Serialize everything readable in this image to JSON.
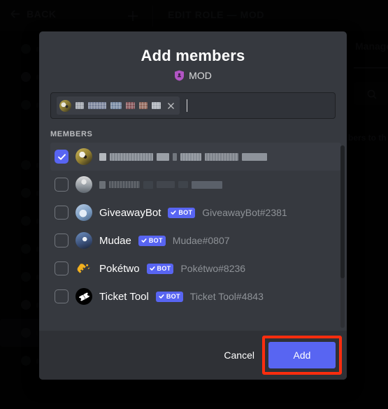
{
  "background": {
    "back_label": "BACK",
    "back_icon": "arrow-left-icon",
    "add_icon": "plus-icon",
    "page_title": "EDIT ROLE — MOD",
    "tab_label": "Manage",
    "search_icon": "search-icon",
    "hint_text": "bers to th"
  },
  "modal": {
    "title": "Add members",
    "role": {
      "name": "MOD",
      "icon": "role-shield-icon",
      "color": "#b155c4"
    },
    "search": {
      "placeholder": "",
      "value": "",
      "token": {
        "avatar": "user-avatar",
        "name_redacted": true,
        "remove_icon": "close-icon"
      }
    },
    "list": {
      "section_label": "MEMBERS",
      "members": [
        {
          "name": "",
          "redacted": true,
          "tag": "",
          "is_bot": false,
          "checked": true,
          "avatar": "dog-avatar",
          "highlighted": true
        },
        {
          "name": "",
          "redacted": true,
          "tag": "",
          "is_bot": false,
          "checked": false,
          "avatar": "person-avatar",
          "highlighted": false
        },
        {
          "name": "GiveawayBot",
          "redacted": false,
          "tag": "GiveawayBot#2381",
          "is_bot": true,
          "bot_label": "BOT",
          "checked": false,
          "avatar": "giveawaybot-avatar",
          "highlighted": false
        },
        {
          "name": "Mudae",
          "redacted": false,
          "tag": "Mudae#0807",
          "is_bot": true,
          "bot_label": "BOT",
          "checked": false,
          "avatar": "mudae-avatar",
          "highlighted": false
        },
        {
          "name": "Pokétwo",
          "redacted": false,
          "tag": "Pokétwo#8236",
          "is_bot": true,
          "bot_label": "BOT",
          "checked": false,
          "avatar": "poketwo-avatar",
          "highlighted": false
        },
        {
          "name": "Ticket Tool",
          "redacted": false,
          "tag": "Ticket Tool#4843",
          "is_bot": true,
          "bot_label": "BOT",
          "checked": false,
          "avatar": "tickettool-avatar",
          "highlighted": false
        }
      ]
    },
    "footer": {
      "cancel_label": "Cancel",
      "add_label": "Add",
      "add_highlighted": true
    }
  },
  "colors": {
    "blurple": "#5865f2",
    "modal_bg": "#36393f",
    "footer_bg": "#2f3136",
    "highlight": "#ff2d0e",
    "role_pink": "#b155c4"
  }
}
